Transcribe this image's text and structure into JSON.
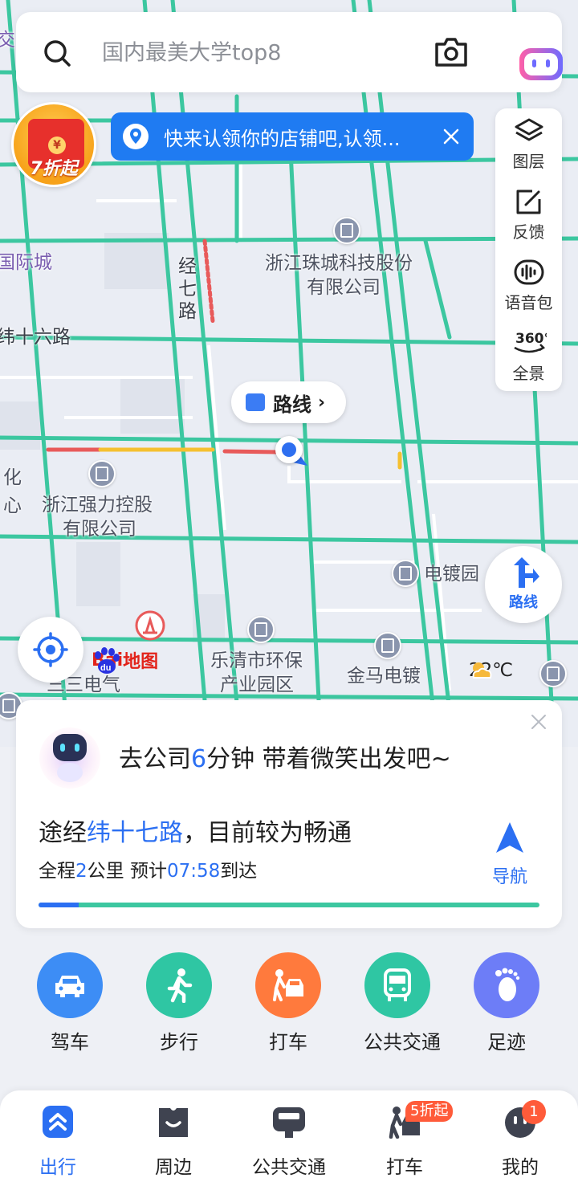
{
  "search": {
    "placeholder": "国内最美大学top8"
  },
  "promo": {
    "badge_text": "7折起"
  },
  "banner": {
    "text": "快来认领你的店铺吧,认领..."
  },
  "tools": [
    {
      "label": "图层",
      "icon": "layers-icon"
    },
    {
      "label": "反馈",
      "icon": "feedback-icon"
    },
    {
      "label": "语音包",
      "icon": "voice-pack-icon"
    },
    {
      "label": "全景",
      "icon": "panorama-360-icon"
    }
  ],
  "map": {
    "route_chip": "路线",
    "route_fab": "路线",
    "labels": {
      "company1_line1": "浙江珠城科技股份",
      "company1_line2": "有限公司",
      "company2_line1": "浙江强力控股",
      "company2_line2": "有限公司",
      "road_jingqi": "经七路",
      "road_wei16": "纬十六路",
      "intl_city": "国际城",
      "electroplating": "电镀园",
      "eco_park_line1": "乐清市环保",
      "eco_park_line2": "产业园区",
      "jinma": "金马电镀",
      "sanqi": "三三电气",
      "jiao": "交",
      "hua": "化",
      "xin": "心"
    },
    "logo": {
      "bai": "Bai",
      "du": "du",
      "ditu": "地图"
    },
    "weather": {
      "temp": "22℃",
      "icon": "partly-cloudy-icon"
    }
  },
  "card": {
    "greeting_pre": "去公司",
    "greeting_num": "6",
    "greeting_post": "分钟 带着微笑出发吧~",
    "via_pre": "途经",
    "via_road": "纬十七路",
    "via_post": "，目前较为畅通",
    "eta_pre": "全程",
    "eta_km": "2",
    "eta_mid": "公里 预计",
    "eta_time": "07:58",
    "eta_post": "到达",
    "nav_label": "导航",
    "progress": 0.08
  },
  "modes": [
    {
      "label": "驾车",
      "icon": "car-icon",
      "color": "#3d8df5"
    },
    {
      "label": "步行",
      "icon": "walk-icon",
      "color": "#2fc6a3"
    },
    {
      "label": "打车",
      "icon": "taxi-icon",
      "color": "#ff7a3d"
    },
    {
      "label": "公共交通",
      "icon": "bus-icon",
      "color": "#2fc6a3"
    },
    {
      "label": "足迹",
      "icon": "footprint-icon",
      "color": "#6d7df7"
    }
  ],
  "bottom_nav": [
    {
      "label": "出行",
      "icon": "travel-icon",
      "active": true
    },
    {
      "label": "周边",
      "icon": "nearby-icon"
    },
    {
      "label": "公共交通",
      "icon": "transit-icon"
    },
    {
      "label": "打车",
      "icon": "taxi-nav-icon",
      "badge": "5折起"
    },
    {
      "label": "我的",
      "icon": "profile-icon",
      "badge": "1"
    }
  ],
  "colors": {
    "accent": "#2b6ff2",
    "traffic_clear": "#3cc7a0",
    "traffic_slow": "#f5c030",
    "traffic_jam": "#e85a5a"
  }
}
